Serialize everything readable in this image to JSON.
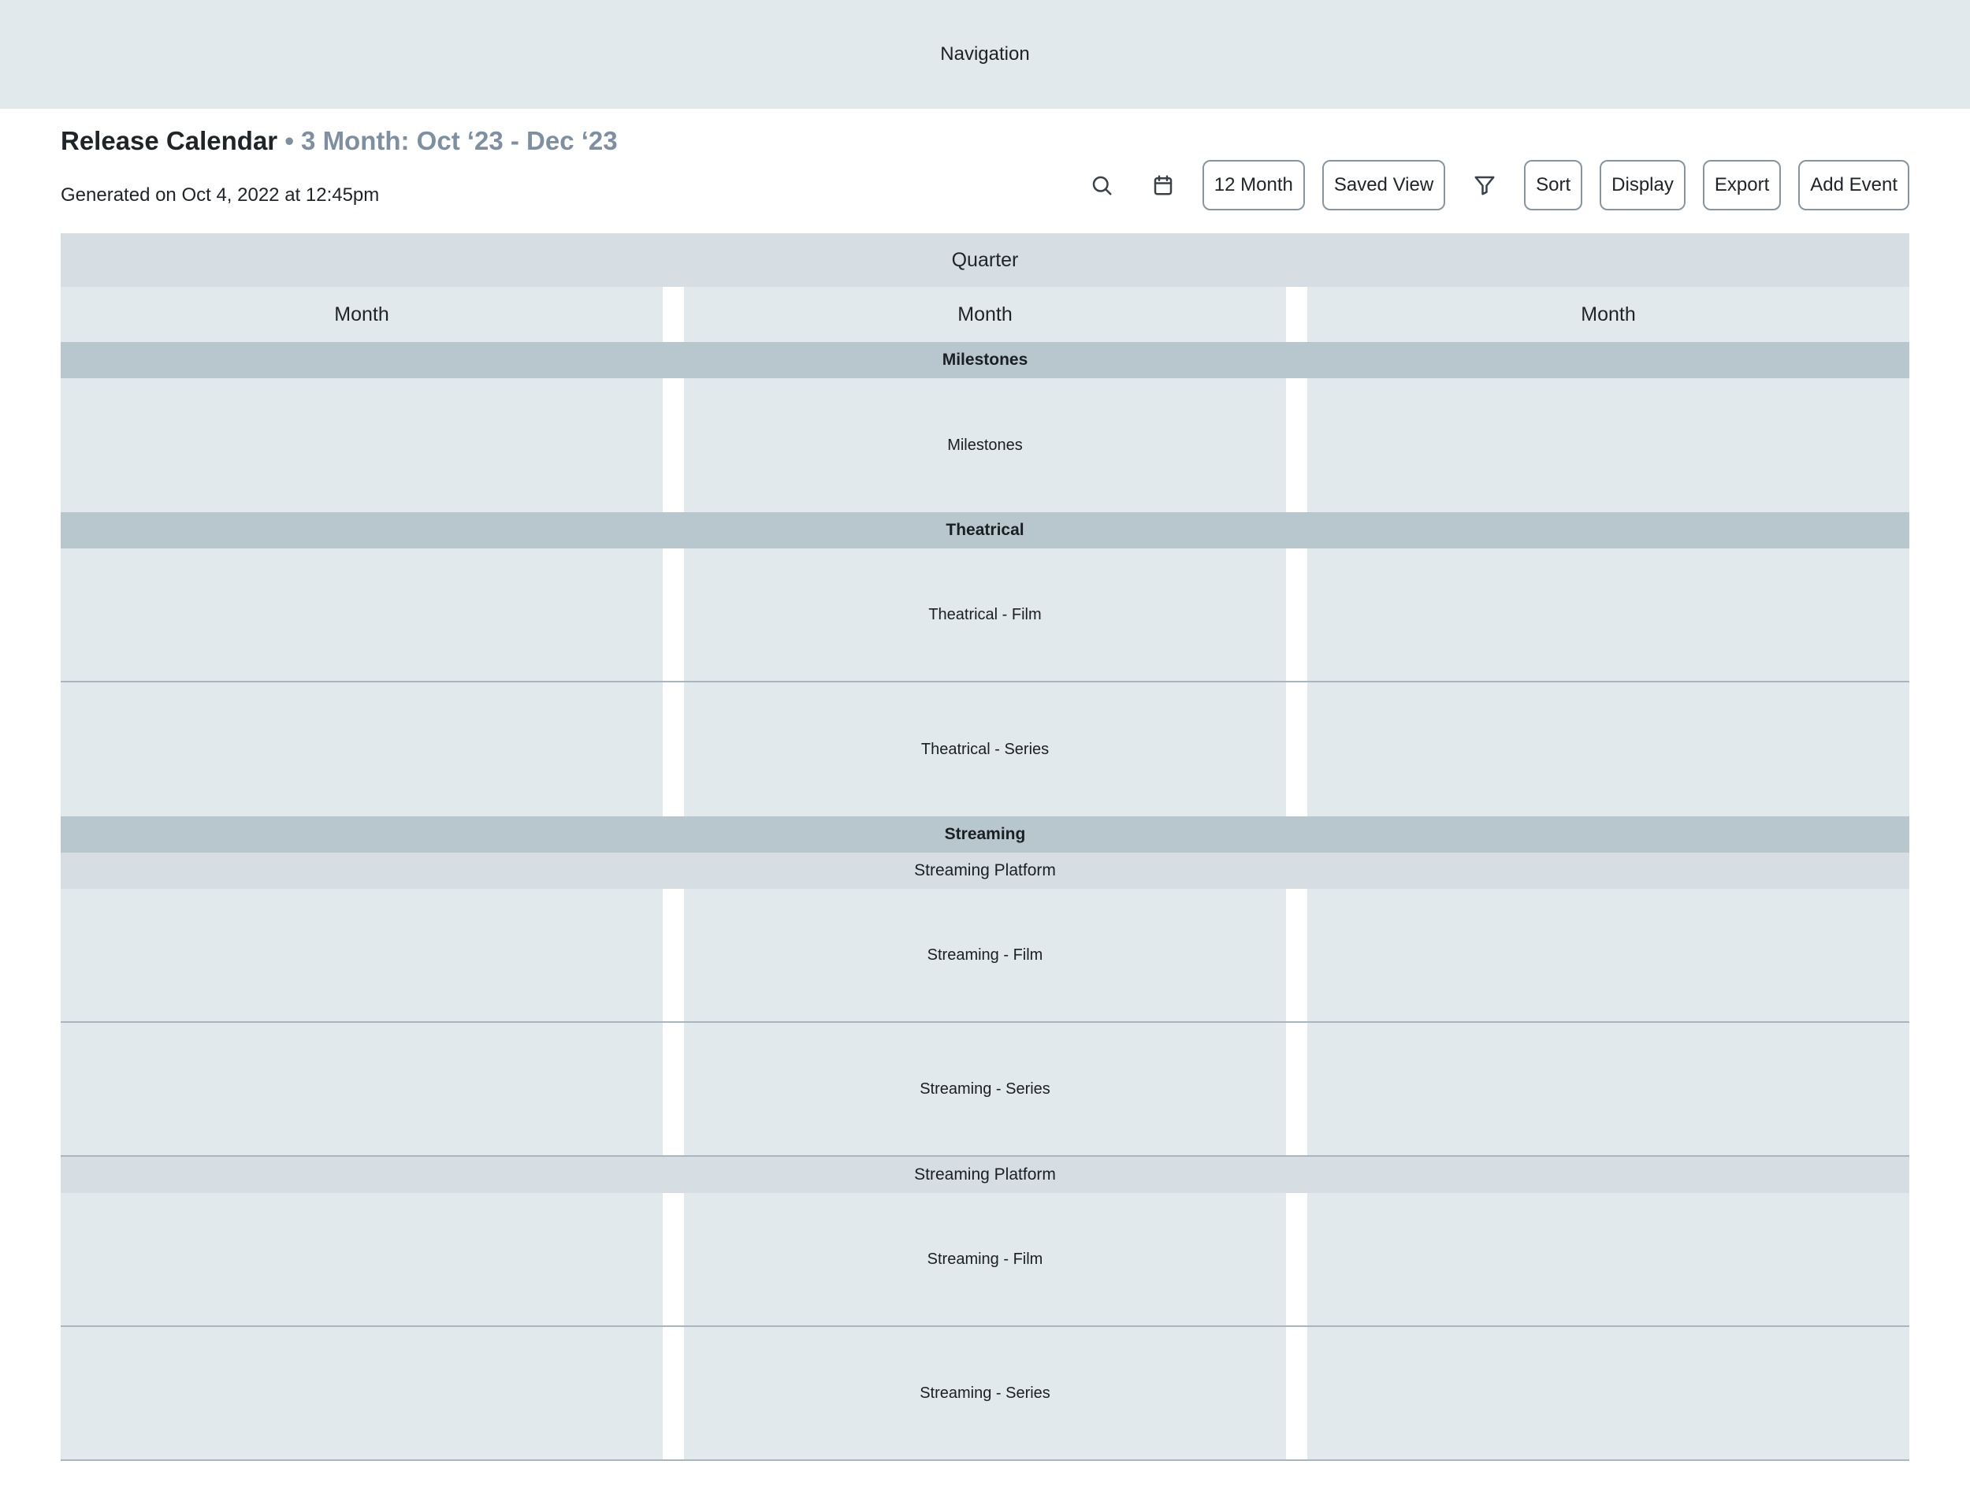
{
  "navigation": {
    "label": "Navigation"
  },
  "header": {
    "title": "Release Calendar",
    "range": " • 3 Month: Oct ‘23 - Dec ‘23",
    "generated": "Generated on Oct 4, 2022 at 12:45pm"
  },
  "toolbar": {
    "search_icon": "search-icon",
    "calendar_icon": "calendar-icon",
    "filter_icon": "filter-icon",
    "twelve_month_label": "12 Month",
    "saved_view_label": "Saved View",
    "sort_label": "Sort",
    "display_label": "Display",
    "export_label": "Export",
    "add_event_label": "Add Event"
  },
  "calendar": {
    "quarter_label": "Quarter",
    "months": [
      "Month",
      "Month",
      "Month"
    ],
    "milestones": {
      "header": "Milestones",
      "row": "Milestones"
    },
    "theatrical": {
      "header": "Theatrical",
      "rows": [
        "Theatrical - Film",
        "Theatrical - Series"
      ]
    },
    "streaming": {
      "header": "Streaming",
      "platforms": [
        {
          "label": "Streaming Platform",
          "rows": [
            "Streaming - Film",
            "Streaming - Series"
          ]
        },
        {
          "label": "Streaming Platform",
          "rows": [
            "Streaming - Film",
            "Streaming - Series"
          ]
        }
      ]
    }
  },
  "colors": {
    "nav_bg": "#e2e9ec",
    "section_header_bg": "#b8c6ce",
    "subheader_bg": "#d6dee4",
    "accent_muted": "#7d8fa0"
  }
}
